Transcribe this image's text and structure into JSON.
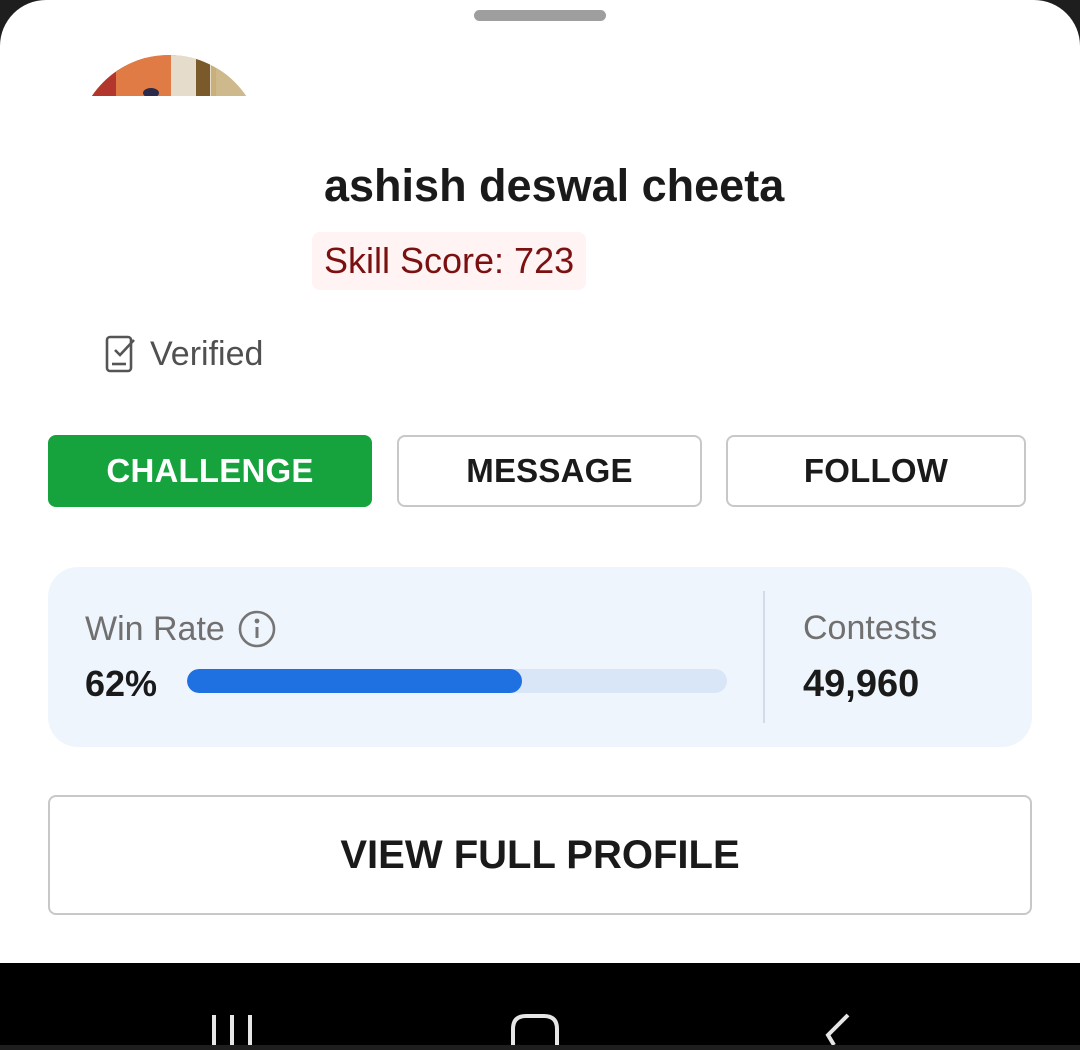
{
  "profile": {
    "name": "ashish deswal cheeta",
    "skill_score": "Skill Score: 723",
    "verified_label": "Verified"
  },
  "actions": {
    "challenge_label": "CHALLENGE",
    "message_label": "MESSAGE",
    "follow_label": "FOLLOW",
    "view_profile_label": "VIEW FULL PROFILE"
  },
  "stats": {
    "win_rate_label": "Win Rate",
    "win_rate_value": "62%",
    "win_rate_fraction": 0.62,
    "contests_label": "Contests",
    "contests_value": "49,960"
  },
  "icons": {
    "verified": "verified-check-icon",
    "info": "info-icon",
    "recents": "recents-icon",
    "home": "home-icon",
    "back": "back-icon"
  },
  "colors": {
    "challenge": "#16a23c",
    "skill_text": "#7a1010",
    "skill_bg": "#fff3f3",
    "progress_fill": "#1f70e0",
    "progress_track": "#d9e6f7",
    "stats_bg": "#eff5fd"
  }
}
